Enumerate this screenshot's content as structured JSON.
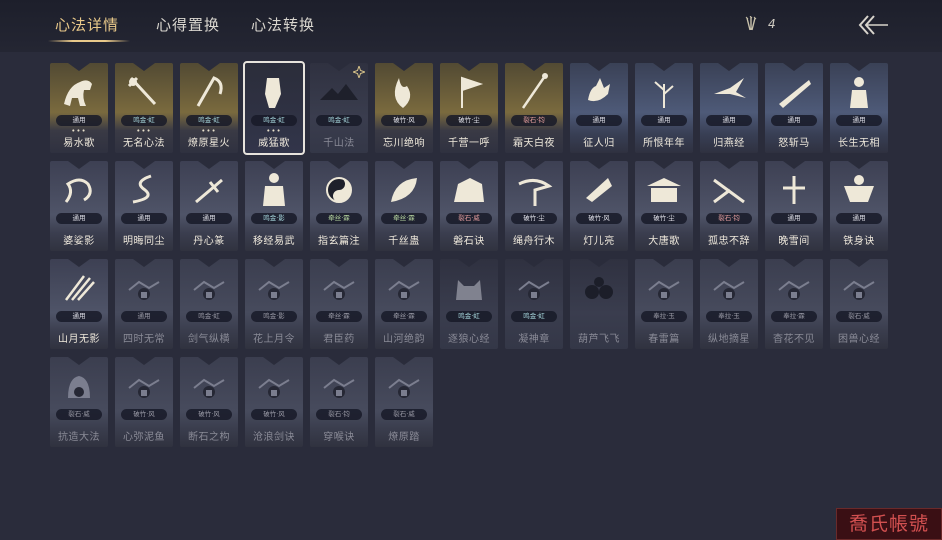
{
  "tabs": [
    {
      "label": "心法详情",
      "active": true
    },
    {
      "label": "心得置换",
      "active": false
    },
    {
      "label": "心法转换",
      "active": false
    }
  ],
  "currency": {
    "count": "4",
    "icon": "arrow-bundle-icon"
  },
  "back_icon": "back-arrow-icon",
  "accent": "#e9c98a",
  "cards": [
    {
      "name": "易水歌",
      "badge": "通用",
      "tier": "gold",
      "dots": "•••",
      "icon": "horse-icon"
    },
    {
      "name": "无名心法",
      "badge": "鸣金·虹",
      "tier": "gold",
      "dots": "•••",
      "icon": "sword-icon"
    },
    {
      "name": "燎原星火",
      "badge": "鸣金·虹",
      "tier": "gold",
      "dots": "•••",
      "icon": "scythe-icon"
    },
    {
      "name": "威猛歌",
      "badge": "鸣金·虹",
      "tier": "selected",
      "dots": "•••",
      "icon": "fist-icon"
    },
    {
      "name": "千山法",
      "badge": "鸣金·虹",
      "tier": "dark",
      "dots": "",
      "icon": "mountain-icon"
    },
    {
      "name": "忘川绝响",
      "badge": "破竹·风",
      "tier": "gold",
      "dots": "",
      "icon": "flame-icon"
    },
    {
      "name": "千营一呼",
      "badge": "破竹·尘",
      "tier": "gold",
      "dots": "",
      "icon": "flag-icon"
    },
    {
      "name": "霜天白夜",
      "badge": "裂石·钧",
      "tier": "gold",
      "dots": "",
      "icon": "staff-icon"
    },
    {
      "name": "征人归",
      "badge": "通用",
      "tier": "blue",
      "dots": "",
      "icon": "hand-icon"
    },
    {
      "name": "所恨年年",
      "badge": "通用",
      "tier": "blue",
      "dots": "",
      "icon": "plant-icon"
    },
    {
      "name": "归燕经",
      "badge": "通用",
      "tier": "blue",
      "dots": "",
      "icon": "swallow-icon"
    },
    {
      "name": "怒斩马",
      "badge": "通用",
      "tier": "blue",
      "dots": "",
      "icon": "blade-icon"
    },
    {
      "name": "长生无相",
      "badge": "通用",
      "tier": "blue",
      "dots": "",
      "icon": "statue-icon"
    },
    {
      "name": "婆娑影",
      "badge": "通用",
      "tier": "gray",
      "dots": "",
      "icon": "dragon-icon"
    },
    {
      "name": "明晦同尘",
      "badge": "通用",
      "tier": "gray",
      "dots": "",
      "icon": "snake-icon"
    },
    {
      "name": "丹心篆",
      "badge": "通用",
      "tier": "gray",
      "dots": "",
      "icon": "brush-icon"
    },
    {
      "name": "移经易武",
      "badge": "鸣金·影",
      "tier": "gray",
      "dots": "",
      "icon": "warrior-icon"
    },
    {
      "name": "指玄篇注",
      "badge": "牵丝·霖",
      "tier": "gray",
      "dots": "",
      "icon": "yinyang-icon"
    },
    {
      "name": "千丝蛊",
      "badge": "牵丝·霖",
      "tier": "gray",
      "dots": "",
      "icon": "leaf-icon"
    },
    {
      "name": "磐石诀",
      "badge": "裂石·威",
      "tier": "gray",
      "dots": "",
      "icon": "rock-icon"
    },
    {
      "name": "绳舟行木",
      "badge": "破竹·尘",
      "tier": "gray",
      "dots": "",
      "icon": "tree-icon"
    },
    {
      "name": "灯儿亮",
      "badge": "破竹·风",
      "tier": "gray",
      "dots": "",
      "icon": "lantern-icon"
    },
    {
      "name": "大唐歌",
      "badge": "破竹·尘",
      "tier": "gray",
      "dots": "",
      "icon": "palace-icon"
    },
    {
      "name": "孤忠不辞",
      "badge": "裂石·钧",
      "tier": "gray",
      "dots": "",
      "icon": "sword-slash-icon"
    },
    {
      "name": "晚雪间",
      "badge": "通用",
      "tier": "gray",
      "dots": "",
      "icon": "cross-icon"
    },
    {
      "name": "铁身诀",
      "badge": "通用",
      "tier": "gray",
      "dots": "",
      "icon": "strongman-icon"
    },
    {
      "name": "山月无影",
      "badge": "通用",
      "tier": "gray",
      "dots": "",
      "icon": "claw-icon"
    },
    {
      "name": "四时无常",
      "badge": "通用",
      "tier": "dim",
      "dots": "",
      "icon": "lock-icon"
    },
    {
      "name": "剑气纵横",
      "badge": "鸣金·虹",
      "tier": "dim",
      "dots": "",
      "icon": "lock-icon"
    },
    {
      "name": "花上月令",
      "badge": "鸣金·影",
      "tier": "dim",
      "dots": "",
      "icon": "lock-icon"
    },
    {
      "name": "君臣药",
      "badge": "牵丝·霖",
      "tier": "dim",
      "dots": "",
      "icon": "lock-icon"
    },
    {
      "name": "山河绝韵",
      "badge": "牵丝·霖",
      "tier": "dim",
      "dots": "",
      "icon": "lock-icon"
    },
    {
      "name": "逐狼心经",
      "badge": "鸣金·虹",
      "tier": "dark",
      "dots": "",
      "icon": "wolf-icon"
    },
    {
      "name": "凝神章",
      "badge": "鸣金·虹",
      "tier": "dark",
      "dots": "",
      "icon": "lock-icon"
    },
    {
      "name": "葫芦飞飞",
      "badge": "",
      "tier": "dark",
      "dots": "",
      "icon": "gourd-icon"
    },
    {
      "name": "春雷篇",
      "badge": "奉拉·玉",
      "tier": "dim",
      "dots": "",
      "icon": "lock-icon"
    },
    {
      "name": "纵地摘星",
      "badge": "奉拉·玉",
      "tier": "dim",
      "dots": "",
      "icon": "lock-icon"
    },
    {
      "name": "杳花不见",
      "badge": "奉拉·霖",
      "tier": "dim",
      "dots": "",
      "icon": "lock-icon"
    },
    {
      "name": "困兽心经",
      "badge": "裂石·威",
      "tier": "dim",
      "dots": "",
      "icon": "lock-icon"
    },
    {
      "name": "抗造大法",
      "badge": "裂石·威",
      "tier": "dim",
      "dots": "",
      "icon": "bell-icon"
    },
    {
      "name": "心弥泥鱼",
      "badge": "破竹·风",
      "tier": "dim",
      "dots": "",
      "icon": "lock-icon"
    },
    {
      "name": "断石之构",
      "badge": "破竹·风",
      "tier": "dim",
      "dots": "",
      "icon": "lock-icon"
    },
    {
      "name": "沧浪剑诀",
      "badge": "破竹·风",
      "tier": "dim",
      "dots": "",
      "icon": "lock-icon"
    },
    {
      "name": "穿喉诀",
      "badge": "裂石·钧",
      "tier": "dim",
      "dots": "",
      "icon": "lock-icon"
    },
    {
      "name": "燎原踏",
      "badge": "裂石·威",
      "tier": "dim",
      "dots": "",
      "icon": "lock-icon"
    }
  ],
  "watermark": "喬氏帳號"
}
